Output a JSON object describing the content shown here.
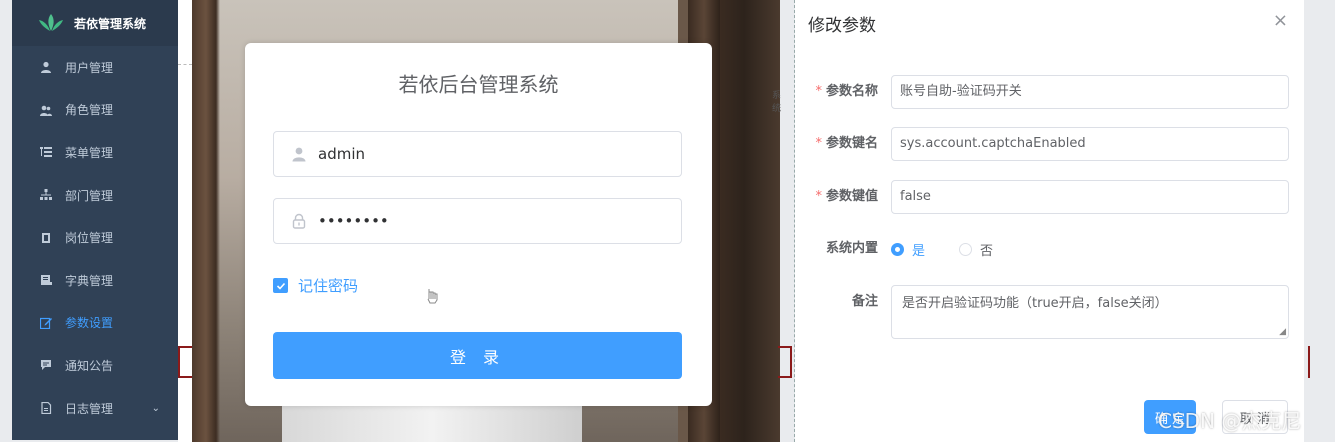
{
  "sidebar": {
    "brand": "若依管理系统",
    "items": [
      {
        "label": "用户管理",
        "icon": "user-icon"
      },
      {
        "label": "角色管理",
        "icon": "peoples-icon"
      },
      {
        "label": "菜单管理",
        "icon": "tree-table-icon"
      },
      {
        "label": "部门管理",
        "icon": "tree-icon"
      },
      {
        "label": "岗位管理",
        "icon": "post-icon"
      },
      {
        "label": "字典管理",
        "icon": "dict-icon"
      },
      {
        "label": "参数设置",
        "icon": "edit-icon",
        "active": true
      },
      {
        "label": "通知公告",
        "icon": "message-icon"
      },
      {
        "label": "日志管理",
        "icon": "log-icon",
        "expandable": true
      }
    ]
  },
  "background": {
    "fragment": "系统"
  },
  "login": {
    "title": "若依后台管理系统",
    "username": "admin",
    "password": "••••••••",
    "remember_label": "记住密码",
    "remember_checked": true,
    "submit_label": "登 录"
  },
  "dialog": {
    "title": "修改参数",
    "close": "×",
    "fields": {
      "name_label": "参数名称",
      "name_value": "账号自助-验证码开关",
      "key_label": "参数键名",
      "key_value": "sys.account.captchaEnabled",
      "value_label": "参数键值",
      "value_value": "false",
      "builtin_label": "系统内置",
      "builtin_yes": "是",
      "builtin_no": "否",
      "builtin_selected": "是",
      "remark_label": "备注",
      "remark_value": "是否开启验证码功能（true开启，false关闭）"
    },
    "confirm_label": "确 定",
    "cancel_label": "取 消"
  },
  "watermark": "CSDN @杰克尼",
  "colors": {
    "sidebar_bg": "#304156",
    "accent": "#409eff",
    "required": "#f56c6c"
  }
}
